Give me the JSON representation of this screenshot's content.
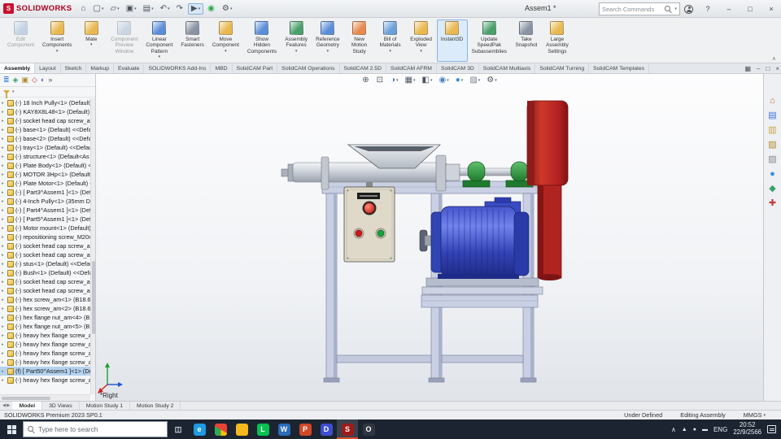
{
  "glyphs": {
    "caret_down": "▾",
    "expand_arrow": "▸",
    "ribbon_collapse": "∧"
  },
  "titlebar": {
    "logo_mark": "S",
    "brand": "SOLIDWORKS",
    "doc_title": "Assem1 *",
    "search_placeholder": "Search Commands",
    "help": "?",
    "minimize": "–",
    "maximize": "□",
    "close": "×"
  },
  "quick_access": [
    {
      "name": "home-icon",
      "glyph": "⌂"
    },
    {
      "name": "new-document-icon",
      "glyph": "▢",
      "caret": "▾"
    },
    {
      "name": "open-icon",
      "glyph": "▱",
      "caret": "▾"
    },
    {
      "name": "save-icon",
      "glyph": "▣",
      "caret": "▾"
    },
    {
      "name": "print-icon",
      "glyph": "▤",
      "caret": "▾"
    },
    {
      "name": "undo-icon",
      "glyph": "↶",
      "caret": "▾"
    },
    {
      "name": "redo-icon",
      "glyph": "↷"
    },
    {
      "name": "select-icon",
      "glyph": "▶",
      "caret": "▾",
      "state": "active"
    },
    {
      "name": "rebuild-icon",
      "glyph": "◉",
      "color": "#2aa84a"
    },
    {
      "name": "options-icon",
      "glyph": "⚙",
      "caret": "▾"
    }
  ],
  "ribbon": {
    "collapse_glyph": "∧",
    "buttons": [
      {
        "name": "edit-component-button",
        "icon": "edit-component-icon",
        "label": "Edit\nComponent",
        "color": "#8fb0d0",
        "state": "disabled"
      },
      {
        "name": "insert-components-button",
        "icon": "insert-components-icon",
        "label": "Insert\nComponents",
        "color": "#e9b84e",
        "caret": "▾"
      },
      {
        "name": "mate-button",
        "icon": "mate-icon",
        "label": "Mate",
        "color": "#e9b84e",
        "caret": "▾"
      },
      {
        "name": "component-preview-button",
        "icon": "component-preview-icon",
        "label": "Component\nPreview\nWindow",
        "color": "#9fb6cf",
        "state": "disabled"
      },
      {
        "name": "linear-pattern-button",
        "icon": "linear-component-pattern-icon",
        "label": "Linear\nComponent\nPattern",
        "color": "#5b8dd9",
        "caret": "▾"
      },
      {
        "name": "smart-fasteners-button",
        "icon": "smart-fasteners-icon",
        "label": "Smart\nFasteners",
        "color": "#8a93a3"
      },
      {
        "name": "move-component-button",
        "icon": "move-component-icon",
        "label": "Move\nComponent",
        "color": "#e9b84e",
        "caret": "▾"
      },
      {
        "name": "show-hidden-button",
        "icon": "show-hidden-components-icon",
        "label": "Show\nHidden\nComponents",
        "color": "#5b8dd9"
      },
      {
        "name": "assembly-features-button",
        "icon": "assembly-features-icon",
        "label": "Assembly\nFeatures",
        "color": "#49a06a",
        "caret": "▾"
      },
      {
        "name": "reference-geometry-button",
        "icon": "reference-geometry-icon",
        "label": "Reference\nGeometry",
        "color": "#5b8dd9",
        "caret": "▾"
      },
      {
        "name": "new-motion-study-button",
        "icon": "new-motion-study-icon",
        "label": "New\nMotion\nStudy",
        "color": "#e8884c"
      },
      {
        "name": "bill-of-materials-button",
        "icon": "bill-of-materials-icon",
        "label": "Bill of\nMaterials",
        "color": "#6a9fd8",
        "caret": "▾"
      },
      {
        "name": "exploded-view-button",
        "icon": "exploded-view-icon",
        "label": "Exploded\nView",
        "color": "#e9b84e",
        "caret": "▾"
      },
      {
        "name": "instant3d-button",
        "icon": "instant3d-icon",
        "label": "Instant3D",
        "color": "#e9b84e",
        "state": "active"
      },
      {
        "name": "update-speedpak-button",
        "icon": "update-speedpak-icon",
        "label": "Update\nSpeedPak\nSubassemblies",
        "color": "#49a06a"
      },
      {
        "name": "take-snapshot-button",
        "icon": "take-snapshot-icon",
        "label": "Take\nSnapshot",
        "color": "#8a93a3"
      },
      {
        "name": "large-assembly-settings-button",
        "icon": "large-assembly-settings-icon",
        "label": "Large\nAssembly\nSettings",
        "color": "#e9b84e"
      }
    ]
  },
  "ribbon_tabs": [
    {
      "label": "Assembly",
      "state": "active"
    },
    {
      "label": "Layout"
    },
    {
      "label": "Sketch"
    },
    {
      "label": "Markup"
    },
    {
      "label": "Evaluate"
    },
    {
      "label": "SOLIDWORKS Add-Ins"
    },
    {
      "label": "MBD"
    },
    {
      "label": "SolidCAM Part"
    },
    {
      "label": "SolidCAM Operations"
    },
    {
      "label": "SolidCAM 2.5D"
    },
    {
      "label": "SolidCAM AFRM"
    },
    {
      "label": "SolidCAM 3D"
    },
    {
      "label": "SolidCAM Multiaxis"
    },
    {
      "label": "SolidCAM Turning"
    },
    {
      "label": "SolidCAM Templates"
    }
  ],
  "doc_controls": [
    {
      "name": "expand-pane-icon",
      "glyph": "▦"
    },
    {
      "name": "minimize-doc-icon",
      "glyph": "–"
    },
    {
      "name": "restore-doc-icon",
      "glyph": "□"
    },
    {
      "name": "close-doc-icon",
      "glyph": "×"
    }
  ],
  "panel_tabs": [
    {
      "name": "featuremanager-tab-icon",
      "glyph": "≣",
      "color": "#2b7cd3"
    },
    {
      "name": "propertymanager-tab-icon",
      "glyph": "◈",
      "color": "#3aa06a"
    },
    {
      "name": "configurationmanager-tab-icon",
      "glyph": "▣",
      "color": "#b08a2a"
    },
    {
      "name": "dimxpertmanager-tab-icon",
      "glyph": "◇",
      "color": "#c43a3a"
    },
    {
      "name": "displaymanager-tab-icon",
      "glyph": "◐",
      "color": "#7a5fd0"
    },
    {
      "name": "expand-panel-tabs-icon",
      "glyph": "»",
      "color": "#555555"
    }
  ],
  "tree": {
    "items": [
      {
        "label": "(-) 18 Inch Pully<1> (Default) ..."
      },
      {
        "label": "(-) KAY8X8L48<1> (Default) <..."
      },
      {
        "label": "(-) socket head cap screw_am..."
      },
      {
        "label": "(-) base<1> (Default) <<Defau..."
      },
      {
        "label": "(-) base<2> (Default) <<Defau..."
      },
      {
        "label": "(-) tray<1> (Default) <<Defaul..."
      },
      {
        "label": "(-) structure<1> (Default<As M..."
      },
      {
        "label": "(-) Plate Body<1> (Default) <<..."
      },
      {
        "label": "(-) MOTOR 3Hp<1> (Default) -..."
      },
      {
        "label": "(-) Plate Motor<1> (Default) <..."
      },
      {
        "label": "(-) [ Part3^Assem1 ]<1> (Defa..."
      },
      {
        "label": "(-) 4-Inch Pully<1> (35mm Dia..."
      },
      {
        "label": "(-) [ Part4^Assem1 ]<1> (Defa..."
      },
      {
        "label": "(-) [ Part5^Assem1 ]<1> (Defa..."
      },
      {
        "label": "(-) Motor mount<1> (Default)..."
      },
      {
        "label": "(-) repositioning screw_M20x2..."
      },
      {
        "label": "(-) socket head cap screw_am..."
      },
      {
        "label": "(-) socket head cap screw_am..."
      },
      {
        "label": "(-) stus<1> (Default) <<Defaul..."
      },
      {
        "label": "(-) Bush<1> (Default) <<Defau..."
      },
      {
        "label": "(-) socket head cap screw_am..."
      },
      {
        "label": "(-) socket head cap screw_am..."
      },
      {
        "label": "(-) hex screw_am<1> (B18.6.7M..."
      },
      {
        "label": "(-) hex screw_am<2> (B18.6.7M..."
      },
      {
        "label": "(-) hex flange nut_am<4> (B18..."
      },
      {
        "label": "(-) hex flange nut_am<5> (B18..."
      },
      {
        "label": "(-) heavy hex flange screw_am..."
      },
      {
        "label": "(-) heavy hex flange screw_am..."
      },
      {
        "label": "(-) heavy hex flange screw_am..."
      },
      {
        "label": "(-) heavy hex flange screw_am..."
      },
      {
        "label": "(f) [ Part50^Assem1 ]<1> (Defa...",
        "state": "selected"
      },
      {
        "label": "(-) heavy hex flange screw_am..."
      }
    ]
  },
  "headsup_icons": [
    {
      "name": "zoom-fit-icon",
      "glyph": "⊕",
      "color": "#4a5560"
    },
    {
      "name": "zoom-area-icon",
      "glyph": "⊡",
      "color": "#4a5560"
    },
    {
      "name": "section-view-icon",
      "glyph": "◑",
      "color": "#4a7fc0",
      "caret": "▾"
    },
    {
      "name": "view-orientation-icon",
      "glyph": "▦",
      "color": "#4a5560",
      "caret": "▾"
    },
    {
      "name": "display-style-icon",
      "glyph": "◧",
      "color": "#4a5560",
      "caret": "▾"
    },
    {
      "name": "hide-show-items-icon",
      "glyph": "◉",
      "color": "#4a7fc0",
      "caret": "▾"
    },
    {
      "name": "edit-appearance-icon",
      "glyph": "●",
      "color": "#3a8fd8",
      "caret": "▾"
    },
    {
      "name": "apply-scene-icon",
      "glyph": "▨",
      "color": "#7a8490",
      "caret": "▾"
    },
    {
      "name": "view-settings-icon",
      "glyph": "⚙",
      "color": "#4a5560",
      "caret": "▾"
    }
  ],
  "viewport": {
    "view_label": "*Right"
  },
  "task_pane_icons": [
    {
      "name": "home-icon",
      "glyph": "⌂",
      "color": "#c46a1f"
    },
    {
      "name": "solidworks-resources-icon",
      "glyph": "▤",
      "color": "#3a6fd8"
    },
    {
      "name": "design-library-icon",
      "glyph": "▥",
      "color": "#caa23a"
    },
    {
      "name": "file-explorer-pane-icon",
      "glyph": "▨",
      "color": "#b08a2a"
    },
    {
      "name": "view-palette-icon",
      "glyph": "▧",
      "color": "#888888"
    },
    {
      "name": "appearances-icon",
      "glyph": "●",
      "color": "#3a8fd8"
    },
    {
      "name": "custom-properties-icon",
      "glyph": "◆",
      "color": "#3aa06a"
    },
    {
      "name": "forum-icon",
      "glyph": "✚",
      "color": "#c43a3a"
    }
  ],
  "model_tabs": {
    "nav": [
      "◀",
      "▶"
    ],
    "tabs": [
      {
        "label": "Model",
        "state": "active"
      },
      {
        "label": "3D Views"
      },
      {
        "label": "Motion Study 1"
      },
      {
        "label": "Motion Study 2"
      }
    ]
  },
  "statusbar": {
    "left": "SOLIDWORKS Premium 2023 SP0.1",
    "right": [
      {
        "label": "Under Defined"
      },
      {
        "label": "Editing Assembly"
      },
      {
        "label": "MMGS",
        "caret": "▾"
      }
    ]
  },
  "taskbar": {
    "search_placeholder": "Type here to search",
    "icons": [
      {
        "name": "task-view-icon",
        "glyph": "◫",
        "color": "transparent",
        "fg": "#dfe6ee",
        "cls": "flat"
      },
      {
        "name": "edge-icon",
        "glyph": "e",
        "color": "#1e9be2",
        "fg": "#ffffff",
        "cls": "circle"
      },
      {
        "name": "chrome-icon",
        "color": "conic-gradient(#ea4335 0deg 120deg, #fbbc05 120deg 180deg, #34a853 180deg 300deg, #ea4335 300deg 360deg)",
        "cls": "circle chrome"
      },
      {
        "name": "file-explorer-icon",
        "color": "#f2b81e",
        "cls": "folder"
      },
      {
        "name": "line-app-icon",
        "glyph": "L",
        "color": "#06c150",
        "fg": "#ffffff",
        "cls": "circle"
      },
      {
        "name": "word-icon",
        "glyph": "W",
        "color": "#2b6cb8",
        "fg": "#ffffff"
      },
      {
        "name": "taskbar-app-icon",
        "glyph": "P",
        "color": "#d24726",
        "fg": "#ffffff"
      },
      {
        "name": "discord-icon",
        "glyph": "D",
        "color": "#3b4fd0",
        "fg": "#ffffff",
        "cls": "circle"
      },
      {
        "name": "solidworks-icon",
        "glyph": "S",
        "color": "#9e1b1b",
        "fg": "#ffffff",
        "state": "active"
      },
      {
        "name": "obs-icon",
        "glyph": "O",
        "color": "#2f3640",
        "fg": "#ffffff",
        "cls": "circle"
      }
    ],
    "tray": {
      "expand_glyph": "∧",
      "icons": [
        {
          "name": "tray-icon-1",
          "glyph": "▲"
        },
        {
          "name": "tray-icon-2",
          "glyph": "●"
        },
        {
          "name": "tray-icon-3",
          "glyph": "▬"
        }
      ],
      "lang": "ENG",
      "time": "20:52",
      "date": "22/9/2566"
    }
  }
}
